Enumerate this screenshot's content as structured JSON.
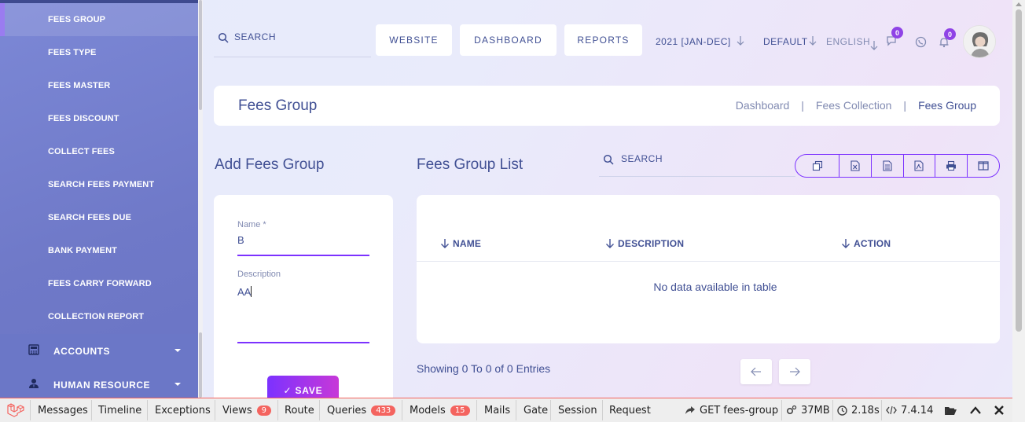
{
  "sidebar": {
    "sub_items": [
      {
        "label": "FEES GROUP",
        "active": true
      },
      {
        "label": "FEES TYPE"
      },
      {
        "label": "FEES MASTER"
      },
      {
        "label": "FEES DISCOUNT"
      },
      {
        "label": "COLLECT FEES"
      },
      {
        "label": "SEARCH FEES PAYMENT"
      },
      {
        "label": "SEARCH FEES DUE"
      },
      {
        "label": "BANK PAYMENT"
      },
      {
        "label": "FEES CARRY FORWARD"
      },
      {
        "label": "COLLECTION REPORT"
      }
    ],
    "main_items": [
      {
        "label": "ACCOUNTS",
        "icon": "calculator-icon"
      },
      {
        "label": "HUMAN RESOURCE",
        "icon": "user-tie-icon"
      }
    ]
  },
  "header": {
    "search_label": "SEARCH",
    "buttons": [
      "WEBSITE",
      "DASHBOARD",
      "REPORTS"
    ],
    "academic_year": "2021 [JAN-DEC]",
    "style": "DEFAULT",
    "language": "ENGLISH",
    "chat_count": "0",
    "notification_count": "0"
  },
  "page": {
    "title": "Fees Group",
    "breadcrumbs": [
      "Dashboard",
      "Fees Collection",
      "Fees Group"
    ],
    "breadcrumb_sep": "|"
  },
  "form": {
    "title": "Add Fees Group",
    "name_label": "Name *",
    "name_value": "B",
    "description_label": "Description",
    "description_value": "AA",
    "save_label": "✓ SAVE"
  },
  "list": {
    "title": "Fees Group List",
    "search_label": "SEARCH",
    "export_icons": [
      "copy-icon",
      "excel-icon",
      "csv-icon",
      "pdf-icon",
      "print-icon",
      "columns-icon"
    ],
    "columns": [
      "NAME",
      "DESCRIPTION",
      "ACTION"
    ],
    "empty_text": "No data available in table",
    "showing": "Showing 0 To 0 of 0 Entries"
  },
  "debugbar": {
    "tabs": [
      "Messages",
      "Timeline",
      "Exceptions",
      "Views",
      "Route",
      "Queries",
      "Models",
      "Mails",
      "Gate",
      "Session",
      "Request"
    ],
    "views_count": "9",
    "queries_count": "433",
    "models_count": "15",
    "route": "GET fees-group",
    "memory": "37MB",
    "time": "2.18s",
    "php_version": "7.4.14"
  },
  "colors": {
    "accent": "#7c32ff",
    "sidebar": "#7c88d6",
    "text": "#415094",
    "debug_badge": "#f4645f"
  }
}
